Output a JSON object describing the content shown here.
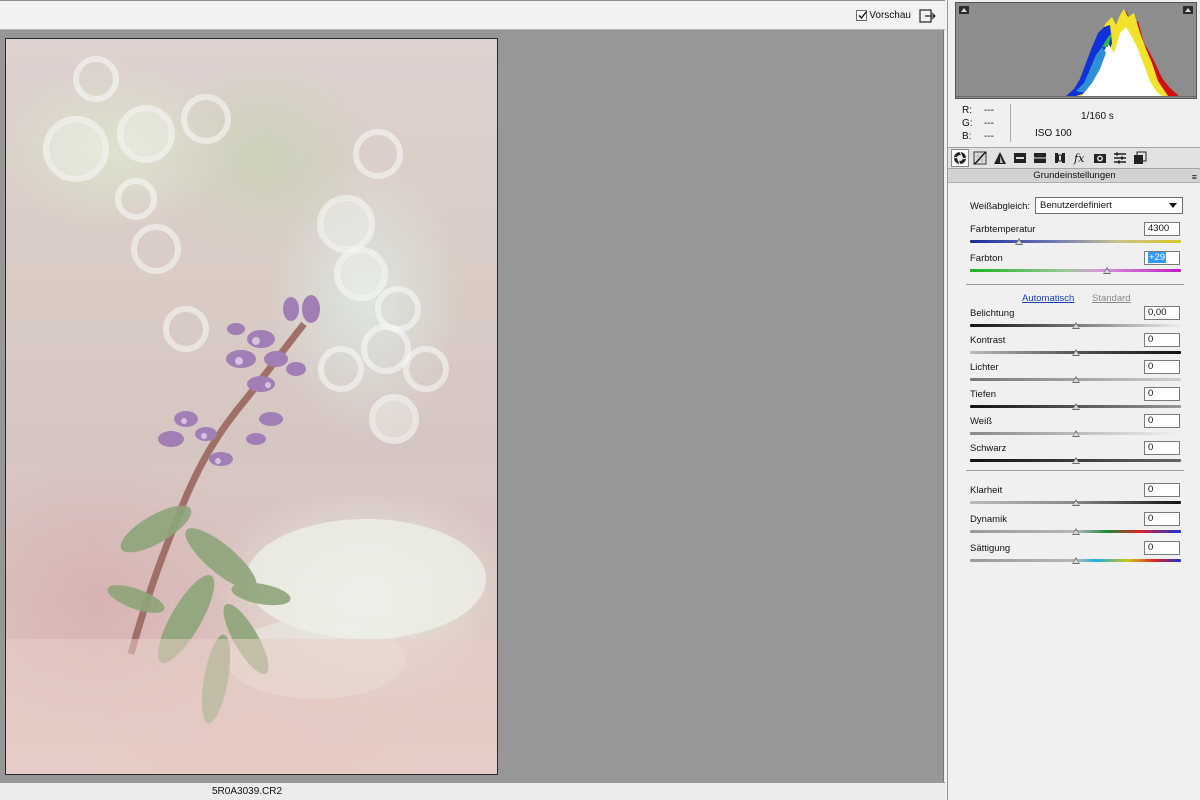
{
  "toolbar": {
    "preview_label": "Vorschau",
    "preview_checked": true
  },
  "canvas": {
    "filename": "5R0A3039.CR2"
  },
  "histogram": {
    "rgb_labels": [
      "R:",
      "G:",
      "B:"
    ],
    "rgb_values": [
      "---",
      "---",
      "---"
    ],
    "shutter": "1/160 s",
    "iso": "ISO 100"
  },
  "tabs": [
    {
      "name": "basic-tab",
      "icon": "aperture-icon",
      "active": true
    },
    {
      "name": "tone-curve-tab",
      "icon": "tone-curve-icon",
      "active": false
    },
    {
      "name": "detail-tab",
      "icon": "detail-triangle-icon",
      "active": false
    },
    {
      "name": "hsl-tab",
      "icon": "hsl-icon",
      "active": false
    },
    {
      "name": "split-toning-tab",
      "icon": "split-toning-icon",
      "active": false
    },
    {
      "name": "lens-corrections-tab",
      "icon": "lens-icon",
      "active": false
    },
    {
      "name": "effects-tab",
      "icon": "fx-icon",
      "active": false
    },
    {
      "name": "camera-calibration-tab",
      "icon": "camera-icon",
      "active": false
    },
    {
      "name": "presets-tab",
      "icon": "presets-icon",
      "active": false
    },
    {
      "name": "snapshots-tab",
      "icon": "snapshots-icon",
      "active": false
    }
  ],
  "panel": {
    "section_title": "Grundeinstellungen",
    "white_balance_label": "Weißabgleich:",
    "white_balance_value": "Benutzerdefiniert",
    "auto_label": "Automatisch",
    "default_label": "Standard",
    "temperature": {
      "label": "Farbtemperatur",
      "value": "4300",
      "position": 0.23
    },
    "tint": {
      "label": "Farbton",
      "value": "+29",
      "position": 0.65
    },
    "adjustments": [
      {
        "label": "Belichtung",
        "value": "0,00",
        "position": 0.5
      },
      {
        "label": "Kontrast",
        "value": "0",
        "position": 0.5
      },
      {
        "label": "Lichter",
        "value": "0",
        "position": 0.5
      },
      {
        "label": "Tiefen",
        "value": "0",
        "position": 0.5
      },
      {
        "label": "Weiß",
        "value": "0",
        "position": 0.5
      },
      {
        "label": "Schwarz",
        "value": "0",
        "position": 0.5
      }
    ],
    "presence": [
      {
        "label": "Klarheit",
        "value": "0",
        "position": 0.5
      },
      {
        "label": "Dynamik",
        "value": "0",
        "position": 0.5
      },
      {
        "label": "Sättigung",
        "value": "0",
        "position": 0.5
      }
    ]
  }
}
